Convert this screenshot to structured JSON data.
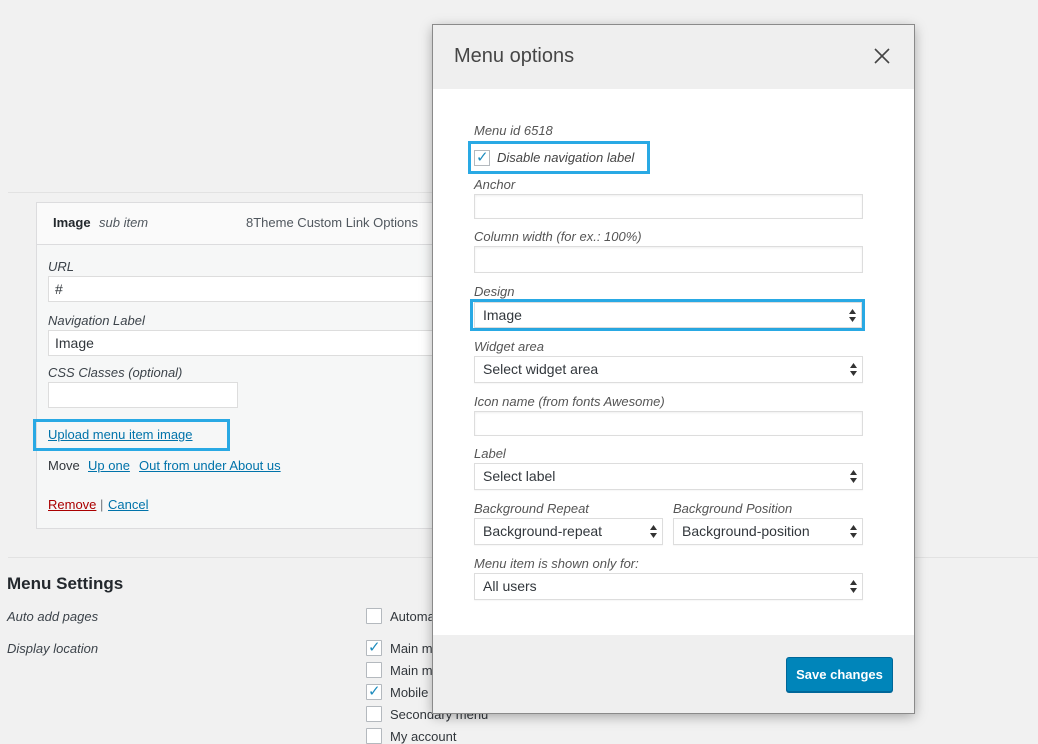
{
  "menu_item": {
    "title": "Image",
    "subtitle": "sub item",
    "type": "8Theme Custom Link Options",
    "url_label": "URL",
    "url_value": "#",
    "nav_label_label": "Navigation Label",
    "nav_label_value": "Image",
    "css_classes_label": "CSS Classes (optional)",
    "upload_link": "Upload menu item image",
    "move_label": "Move",
    "move_up": "Up one",
    "move_out": "Out from under About us",
    "remove": "Remove",
    "separator": "|",
    "cancel": "Cancel"
  },
  "menu_settings": {
    "title": "Menu Settings",
    "auto_add_label": "Auto add pages",
    "display_location_label": "Display location",
    "auto_add_option": {
      "label": "Automa",
      "checked": false
    },
    "locations": [
      {
        "label": "Main m",
        "checked": true
      },
      {
        "label": "Main m",
        "checked": false
      },
      {
        "label": "Mobile",
        "checked": true
      },
      {
        "label": "Secondary menu",
        "checked": false
      },
      {
        "label": "My account",
        "checked": false
      }
    ]
  },
  "modal": {
    "title": "Menu options",
    "menu_id": "Menu id 6518",
    "disable_nav_label": "Disable navigation label",
    "disable_nav_checked": true,
    "anchor_label": "Anchor",
    "anchor_value": "",
    "column_width_label": "Column width (for ex.: 100%)",
    "column_width_value": "",
    "design_label": "Design",
    "design_value": "Image",
    "widget_area_label": "Widget area",
    "widget_area_value": "Select widget area",
    "icon_name_label": "Icon name (from fonts Awesome)",
    "icon_name_value": "",
    "label_label": "Label",
    "label_value": "Select label",
    "bg_repeat_label": "Background Repeat",
    "bg_repeat_value": "Background-repeat",
    "bg_position_label": "Background Position",
    "bg_position_value": "Background-position",
    "shown_for_label": "Menu item is shown only for:",
    "shown_for_value": "All users",
    "save_button": "Save changes"
  },
  "colors": {
    "highlight": "#29a9e4",
    "primary_button": "#0085ba",
    "link": "#0073aa"
  }
}
